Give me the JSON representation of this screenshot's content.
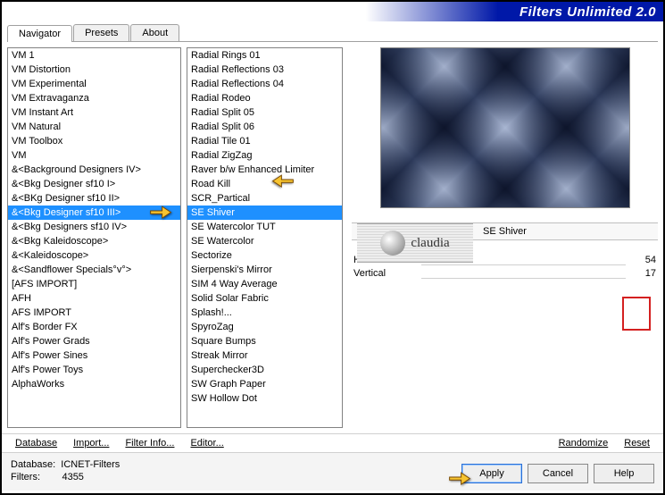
{
  "title": "Filters Unlimited 2.0",
  "tabs": [
    "Navigator",
    "Presets",
    "About"
  ],
  "active_tab": 0,
  "category_list": {
    "selected_index": 11,
    "items": [
      "VM 1",
      "VM Distortion",
      "VM Experimental",
      "VM Extravaganza",
      "VM Instant Art",
      "VM Natural",
      "VM Toolbox",
      "VM",
      "&<Background Designers IV>",
      "&<Bkg Designer sf10 I>",
      "&<BKg Designer sf10 II>",
      "&<Bkg Designer sf10 III>",
      "&<Bkg Designers sf10 IV>",
      "&<Bkg Kaleidoscope>",
      "&<Kaleidoscope>",
      "&<Sandflower Specials°v°>",
      "[AFS IMPORT]",
      "AFH",
      "AFS IMPORT",
      "Alf's Border FX",
      "Alf's Power Grads",
      "Alf's Power Sines",
      "Alf's Power Toys",
      "AlphaWorks"
    ]
  },
  "filter_list": {
    "selected_index": 10,
    "items": [
      "Radial  Rings 01",
      "Radial Reflections 03",
      "Radial Reflections 04",
      "Radial Rodeo",
      "Radial Split 05",
      "Radial Split 06",
      "Radial Tile 01",
      "Radial ZigZag",
      "Raver b/w Enhanced Limiter",
      "Road Kill",
      "SCR_Partical",
      "SE Shiver",
      "SE Watercolor TUT",
      "SE Watercolor",
      "Sectorize",
      "Sierpenski's Mirror",
      "SIM 4 Way Average",
      "Solid Solar Fabric",
      "Splash!...",
      "SpyroZag",
      "Square Bumps",
      "Streak Mirror",
      "Superchecker3D",
      "SW Graph Paper",
      "SW Hollow Dot"
    ]
  },
  "current_filter": "SE Shiver",
  "params": [
    {
      "label": "Horizontal",
      "value": 54
    },
    {
      "label": "Vertical",
      "value": 17
    }
  ],
  "toolbar": {
    "database": "Database",
    "import": "Import...",
    "filter_info": "Filter Info...",
    "editor": "Editor...",
    "randomize": "Randomize",
    "reset": "Reset"
  },
  "status": {
    "db_label": "Database:",
    "db_value": "ICNET-Filters",
    "filters_label": "Filters:",
    "filters_value": "4355"
  },
  "buttons": {
    "apply": "Apply",
    "cancel": "Cancel",
    "help": "Help"
  },
  "watermark": "claudia"
}
